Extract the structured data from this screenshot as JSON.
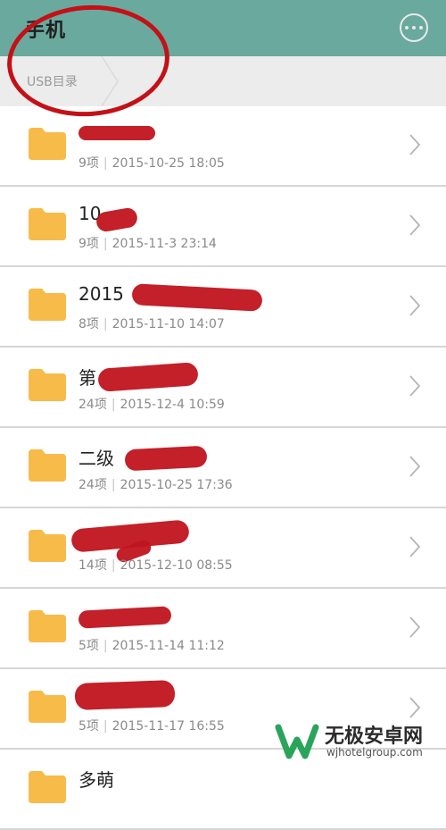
{
  "header": {
    "title": "手机",
    "more_icon": "more-horizontal-icon"
  },
  "breadcrumb": {
    "label": "USB目录"
  },
  "folders": [
    {
      "name": "",
      "count": "9项",
      "date": "2015-10-25 18:05"
    },
    {
      "name": "10",
      "count": "9项",
      "date": "2015-11-3 23:14"
    },
    {
      "name": "2015",
      "count": "8项",
      "date": "2015-11-10 14:07"
    },
    {
      "name": "第",
      "count": "24项",
      "date": "2015-12-4 10:59"
    },
    {
      "name": "二级",
      "count": "24项",
      "date": "2015-10-25 17:36"
    },
    {
      "name": "",
      "count": "14项",
      "date": "2015-12-10 08:55"
    },
    {
      "name": "",
      "count": "5项",
      "date": "2015-11-14 11:12"
    },
    {
      "name": "",
      "count": "5项",
      "date": "2015-11-17 16:55"
    },
    {
      "name": "多萌",
      "count": "",
      "date": ""
    }
  ],
  "watermark": {
    "brand": "无极安卓网",
    "url": "wjhotelgroup.com"
  },
  "colors": {
    "header": "#6aa99e",
    "folder": "#f7bb4a",
    "annotation": "#c41017"
  }
}
